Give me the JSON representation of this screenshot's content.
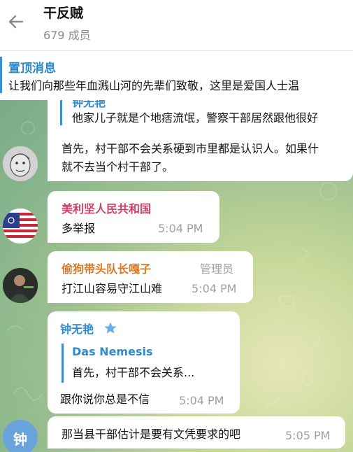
{
  "header": {
    "title": "干反贼",
    "members": "679 成员"
  },
  "pinned": {
    "label": "置顶消息",
    "text": "让我们向那些年血溅山河的先辈们致敬，这里是爱国人士温"
  },
  "messages": [
    {
      "quote_name": "钟无艳",
      "quote_text": "他家儿子就是个地痞流氓，警察干部居然跟他很好",
      "line1": "首先，村干部不会关系硬到市里都是认识人。如果什",
      "line2": "就不去当个村干部了。"
    },
    {
      "sender": "美利坚人民共和国",
      "sender_color": "#d0406a",
      "text": "多举报",
      "time": "5:04 PM"
    },
    {
      "sender": "偷狗带头队长嘎子",
      "sender_color": "#d67a26",
      "role": "管理员",
      "text": "打江山容易守江山难",
      "time": "5:04 PM"
    },
    {
      "sender": "钟无艳",
      "sender_color": "#2d8bd0",
      "quote_name": "Das Nemesis",
      "quote_text": "首先，村干部不会关系...",
      "text": "跟你说你总是不信",
      "time": "5:04 PM"
    },
    {
      "avatar_letter": "钟",
      "text": "那当县干部估计是要有文凭要求的吧",
      "time": "5:05 PM"
    }
  ],
  "colors": {
    "accent": "#2d8bd0",
    "avatar_blue": "#6aa3dc",
    "star": "#66aee8"
  }
}
